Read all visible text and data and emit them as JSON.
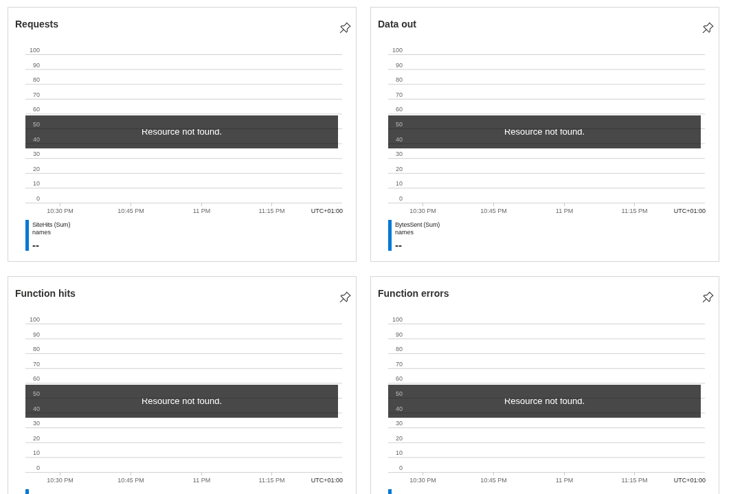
{
  "cards": [
    {
      "title": "Requests",
      "message": "Resource not found.",
      "timezone": "UTC+01:00",
      "chart_data": {
        "type": "line",
        "categories": [
          "10:30 PM",
          "10:45 PM",
          "11 PM",
          "11:15 PM"
        ],
        "ylim": [
          0,
          100
        ],
        "yticks": [
          0,
          10,
          20,
          30,
          40,
          50,
          60,
          70,
          80,
          90,
          100
        ],
        "grid": true
      },
      "legend": {
        "name": "SiteHits (Sum)",
        "subtitle": "names",
        "value": "--"
      }
    },
    {
      "title": "Data out",
      "message": "Resource not found.",
      "timezone": "UTC+01:00",
      "chart_data": {
        "type": "line",
        "categories": [
          "10:30 PM",
          "10:45 PM",
          "11 PM",
          "11:15 PM"
        ],
        "ylim": [
          0,
          100
        ],
        "yticks": [
          0,
          10,
          20,
          30,
          40,
          50,
          60,
          70,
          80,
          90,
          100
        ],
        "grid": true
      },
      "legend": {
        "name": "BytesSent (Sum)",
        "subtitle": "names",
        "value": "--"
      }
    },
    {
      "title": "Function hits",
      "message": "Resource not found.",
      "timezone": "UTC+01:00",
      "chart_data": {
        "type": "line",
        "categories": [
          "10:30 PM",
          "10:45 PM",
          "11 PM",
          "11:15 PM"
        ],
        "ylim": [
          0,
          100
        ],
        "yticks": [
          0,
          10,
          20,
          30,
          40,
          50,
          60,
          70,
          80,
          90,
          100
        ],
        "grid": true
      }
    },
    {
      "title": "Function errors",
      "message": "Resource not found.",
      "timezone": "UTC+01:00",
      "chart_data": {
        "type": "line",
        "categories": [
          "10:30 PM",
          "10:45 PM",
          "11 PM",
          "11:15 PM"
        ],
        "ylim": [
          0,
          100
        ],
        "yticks": [
          0,
          10,
          20,
          30,
          40,
          50,
          60,
          70,
          80,
          90,
          100
        ],
        "grid": true
      }
    }
  ]
}
